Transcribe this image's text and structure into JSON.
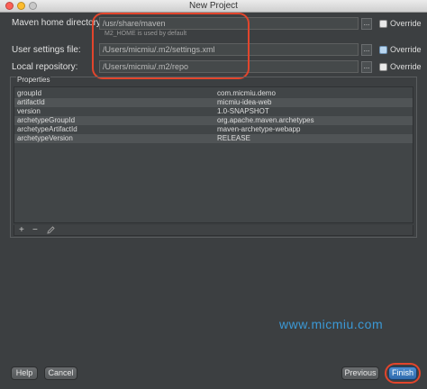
{
  "window": {
    "title": "New Project"
  },
  "form": {
    "maven_home": {
      "label": "Maven home directory:",
      "value": "/usr/share/maven",
      "hint": "M2_HOME is used by default"
    },
    "settings_file": {
      "label": "User settings file:",
      "value": "/Users/micmiu/.m2/settings.xml"
    },
    "local_repo": {
      "label": "Local repository:",
      "value": "/Users/micmiu/.m2/repo"
    },
    "browse_label": "...",
    "override_label": "Override"
  },
  "properties": {
    "header": "Properties",
    "rows": [
      {
        "key": "groupId",
        "value": "com.micmiu.demo"
      },
      {
        "key": "artifactId",
        "value": "micmiu-idea-web"
      },
      {
        "key": "version",
        "value": "1.0-SNAPSHOT"
      },
      {
        "key": "archetypeGroupId",
        "value": "org.apache.maven.archetypes"
      },
      {
        "key": "archetypeArtifactId",
        "value": "maven-archetype-webapp"
      },
      {
        "key": "archetypeVersion",
        "value": "RELEASE"
      }
    ],
    "toolbar": {
      "add": "+",
      "remove": "−"
    }
  },
  "watermark": "www.micmiu.com",
  "buttons": {
    "help": "Help",
    "cancel": "Cancel",
    "previous": "Previous",
    "finish": "Finish"
  },
  "colors": {
    "background": "#3c3f41",
    "highlight_oval": "#e2452c",
    "watermark": "#3b99d6",
    "primary_button": "#3a78bf"
  }
}
